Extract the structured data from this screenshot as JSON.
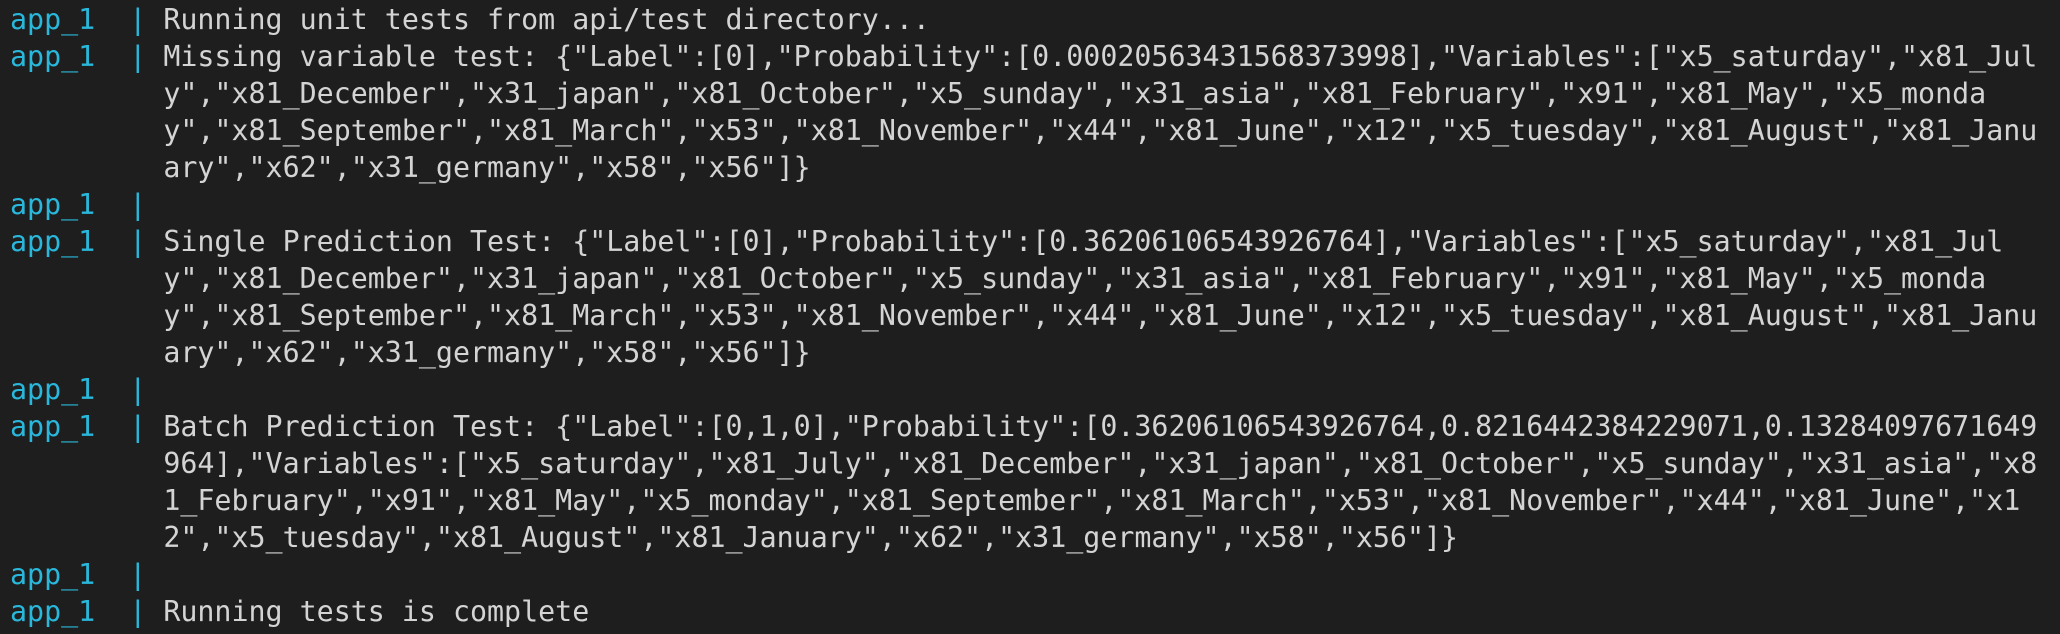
{
  "terminal": {
    "prefix": "app_1  | ",
    "lines": [
      "Running unit tests from api/test directory...",
      "Missing variable test: {\"Label\":[0],\"Probability\":[0.00020563431568373998],\"Variables\":[\"x5_saturday\",\"x81_July\",\"x81_December\",\"x31_japan\",\"x81_October\",\"x5_sunday\",\"x31_asia\",\"x81_February\",\"x91\",\"x81_May\",\"x5_monday\",\"x81_September\",\"x81_March\",\"x53\",\"x81_November\",\"x44\",\"x81_June\",\"x12\",\"x5_tuesday\",\"x81_August\",\"x81_January\",\"x62\",\"x31_germany\",\"x58\",\"x56\"]}",
      "",
      "Single Prediction Test: {\"Label\":[0],\"Probability\":[0.36206106543926764],\"Variables\":[\"x5_saturday\",\"x81_July\",\"x81_December\",\"x31_japan\",\"x81_October\",\"x5_sunday\",\"x31_asia\",\"x81_February\",\"x91\",\"x81_May\",\"x5_monday\",\"x81_September\",\"x81_March\",\"x53\",\"x81_November\",\"x44\",\"x81_June\",\"x12\",\"x5_tuesday\",\"x81_August\",\"x81_January\",\"x62\",\"x31_germany\",\"x58\",\"x56\"]}",
      "",
      "Batch Prediction Test: {\"Label\":[0,1,0],\"Probability\":[0.36206106543926764,0.8216442384229071,0.13284097671649964],\"Variables\":[\"x5_saturday\",\"x81_July\",\"x81_December\",\"x31_japan\",\"x81_October\",\"x5_sunday\",\"x31_asia\",\"x81_February\",\"x91\",\"x81_May\",\"x5_monday\",\"x81_September\",\"x81_March\",\"x53\",\"x81_November\",\"x44\",\"x81_June\",\"x12\",\"x5_tuesday\",\"x81_August\",\"x81_January\",\"x62\",\"x31_germany\",\"x58\",\"x56\"]}",
      "",
      "Running tests is complete"
    ]
  },
  "colors": {
    "background": "#1e1e1e",
    "text": "#d4d4d4",
    "prefix": "#29b8db"
  }
}
